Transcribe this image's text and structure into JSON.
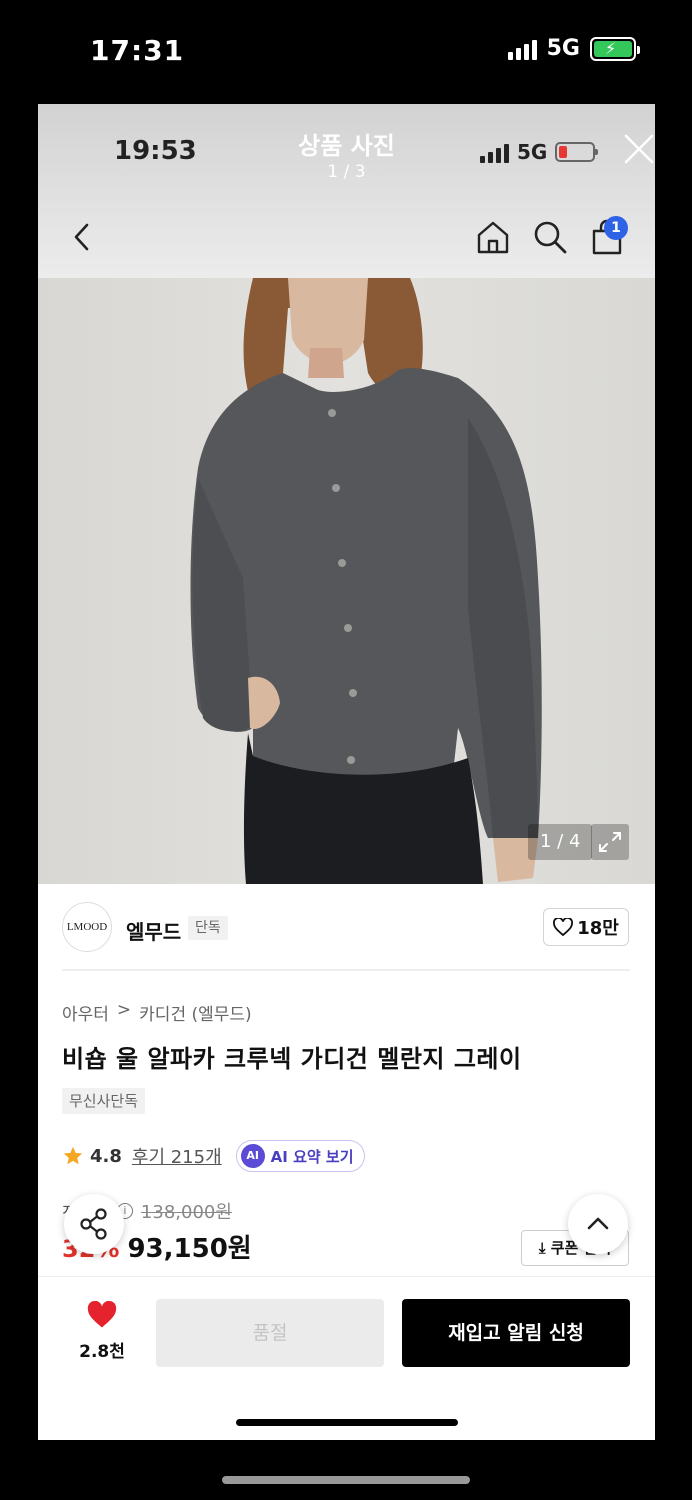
{
  "outer_status": {
    "time": "17:31",
    "network": "5G"
  },
  "inner_status": {
    "time": "19:53",
    "network": "5G"
  },
  "viewer": {
    "title": "상품 사진",
    "counter": "1 / 3"
  },
  "header": {
    "cart_count": "1"
  },
  "image": {
    "counter": "1 / 4"
  },
  "brand": {
    "logo_text": "LMOOD",
    "name": "엘무드",
    "tag": "단독",
    "likes": "18만"
  },
  "breadcrumb": {
    "category": "아우터",
    "separator": ">",
    "subcategory": "카디건 (엘무드)"
  },
  "product": {
    "title": "비숍 울 알파카 크루넥 가디건 멜란지 그레이",
    "exclusive_tag": "무신사단독",
    "rating": "4.8",
    "reviews": "후기 215개",
    "ai_badge": "AI",
    "ai_summary": "AI 요약 보기"
  },
  "price": {
    "label_partial": "정상가",
    "original": "138,000원",
    "discount_partial": "32%",
    "sale": "93,150원",
    "coupon_partial": "쿠폰 받기"
  },
  "bottom_bar": {
    "wish_count": "2.8천",
    "soldout_label": "품절",
    "restock_label": "재입고 알림 신청"
  },
  "colors": {
    "accent_blue": "#2f63e6",
    "discount_red": "#e0322b",
    "heart_red": "#e5232f"
  }
}
